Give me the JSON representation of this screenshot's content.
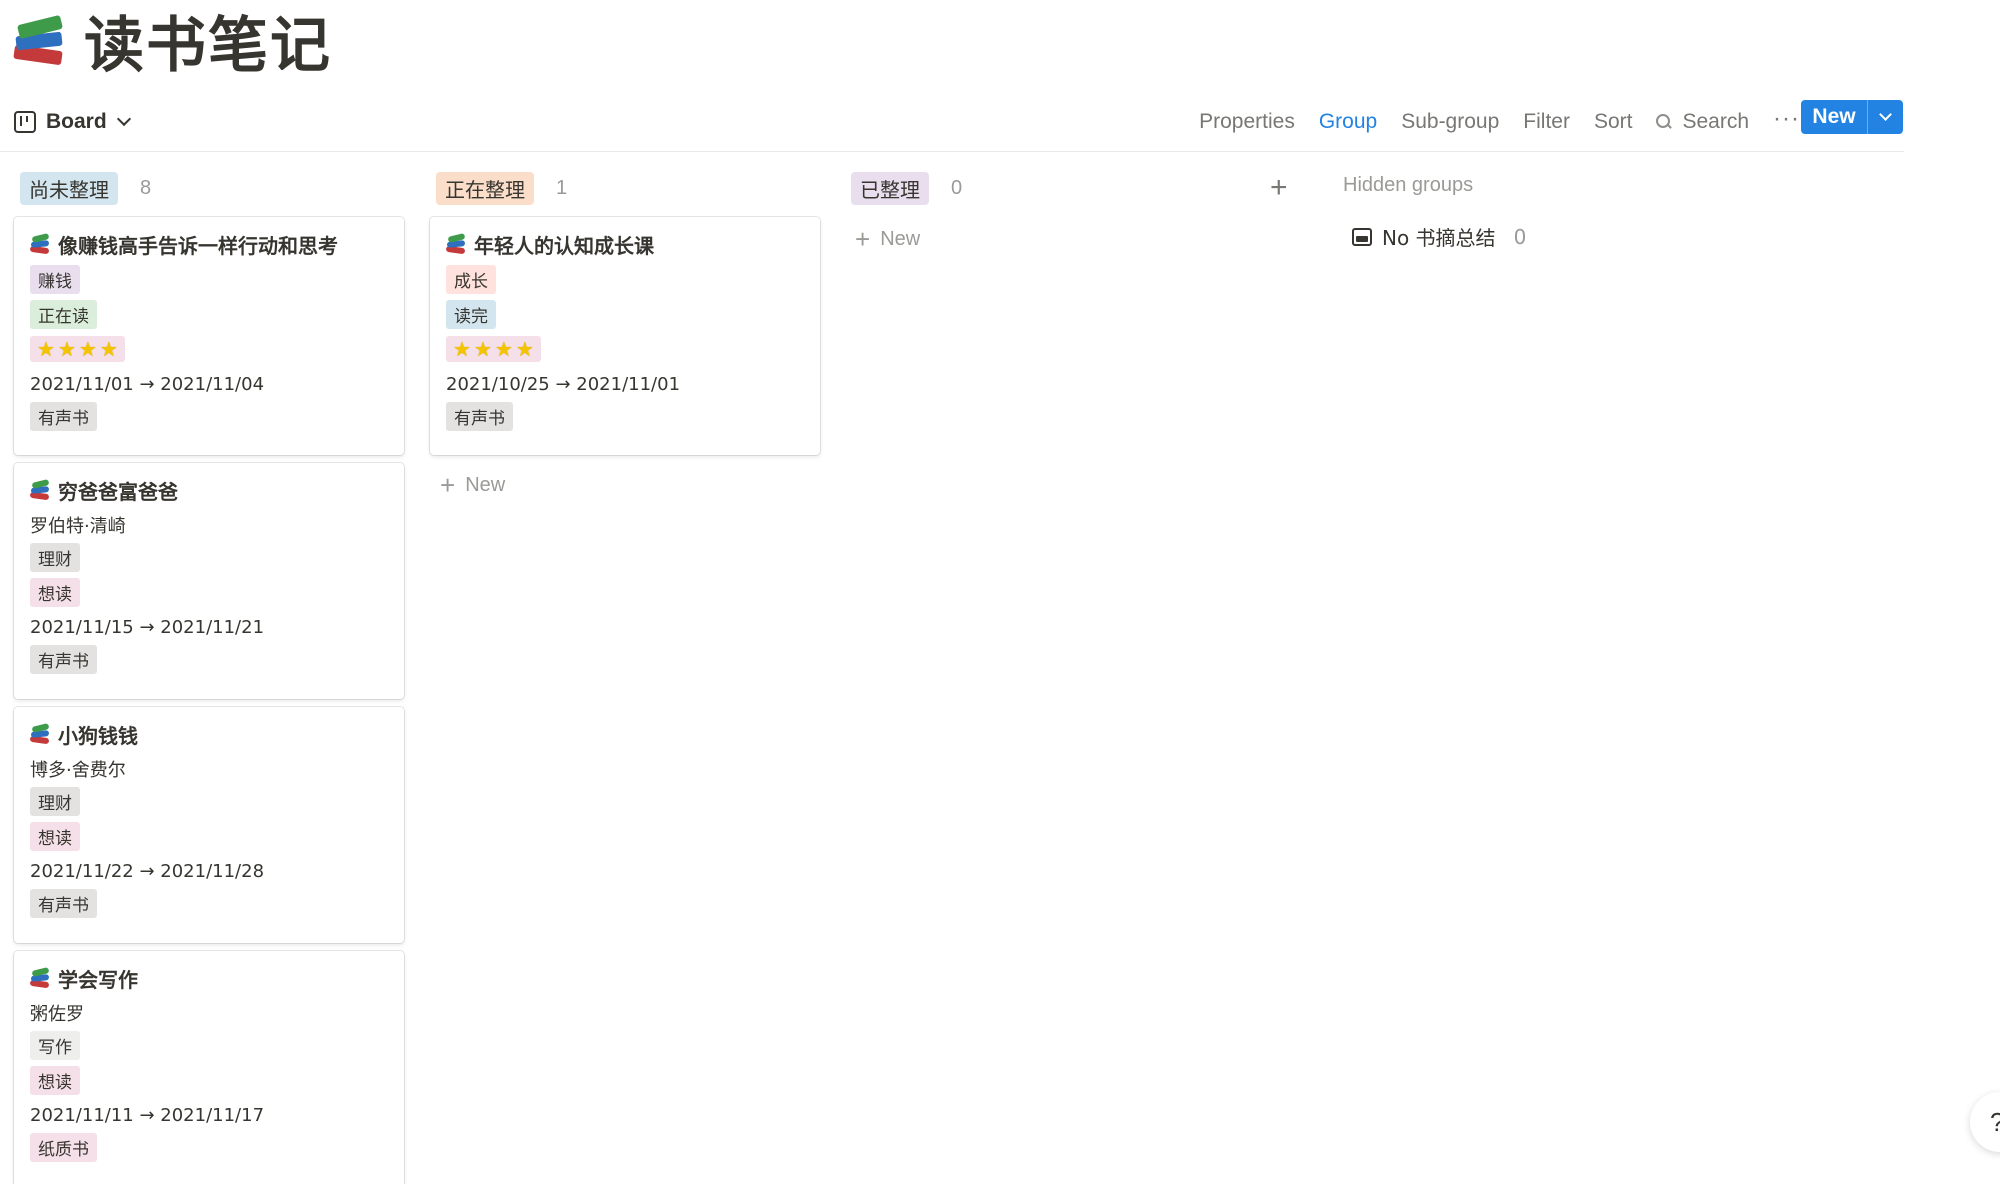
{
  "page": {
    "title": "读书笔记",
    "icon": "books-icon"
  },
  "toolbar": {
    "view_name": "Board",
    "properties": "Properties",
    "group": "Group",
    "subgroup": "Sub-group",
    "filter": "Filter",
    "sort": "Sort",
    "search": "Search",
    "more": "···",
    "new_label": "New",
    "accent_color": "#2383e2"
  },
  "columns": [
    {
      "name": "尚未整理",
      "count": "8",
      "color": "#d3e5ef",
      "cards": [
        {
          "title": "像赚钱高手告诉一样行动和思考",
          "category": "赚钱",
          "category_color": "#e8deee",
          "status": "正在读",
          "status_color": "#dbeddb",
          "rating": "⭐⭐⭐⭐",
          "dates": "2021/11/01 → 2021/11/04",
          "format": "有声书",
          "format_color": "#e3e2e0"
        },
        {
          "title": "穷爸爸富爸爸",
          "author": "罗伯特·清崎",
          "category": "理财",
          "category_color": "#e3e2e0",
          "status": "想读",
          "status_color": "#f5e0e9",
          "dates": "2021/11/15 → 2021/11/21",
          "format": "有声书",
          "format_color": "#e3e2e0"
        },
        {
          "title": "小狗钱钱",
          "author": "博多·舍费尔",
          "category": "理财",
          "category_color": "#e3e2e0",
          "status": "想读",
          "status_color": "#f5e0e9",
          "dates": "2021/11/22 → 2021/11/28",
          "format": "有声书",
          "format_color": "#e3e2e0"
        },
        {
          "title": "学会写作",
          "author": "粥佐罗",
          "category": "写作",
          "category_color": "#eeeeed",
          "status": "想读",
          "status_color": "#f5e0e9",
          "dates": "2021/11/11 → 2021/11/17",
          "format": "纸质书",
          "format_color": "#f5e0e9"
        }
      ]
    },
    {
      "name": "正在整理",
      "count": "1",
      "color": "#fadec9",
      "cards": [
        {
          "title": "年轻人的认知成长课",
          "category": "成长",
          "category_color": "#ffe2dd",
          "status": "读完",
          "status_color": "#d3e5ef",
          "rating": "⭐⭐⭐⭐",
          "dates": "2021/10/25 → 2021/11/01",
          "format": "有声书",
          "format_color": "#e3e2e0"
        }
      ],
      "add_label": "New"
    },
    {
      "name": "已整理",
      "count": "0",
      "color": "#e8deee",
      "add_label": "New"
    }
  ],
  "hidden_groups": {
    "title": "Hidden groups",
    "items": [
      {
        "label": "No 书摘总结",
        "count": "0"
      }
    ]
  },
  "help": "?"
}
